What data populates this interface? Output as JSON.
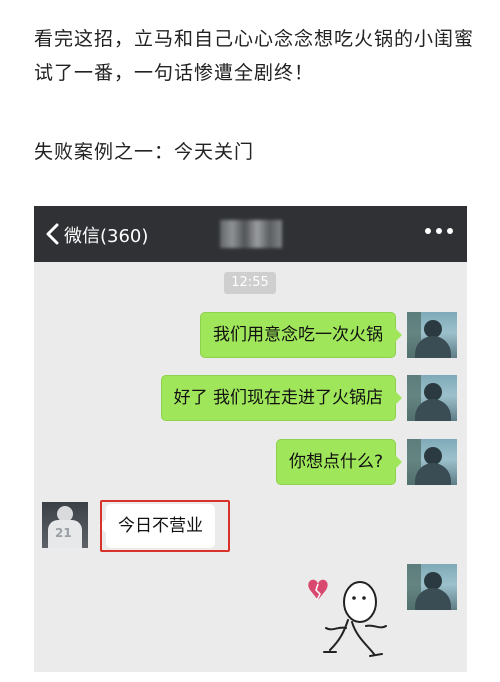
{
  "article": {
    "intro": "看完这招，立马和自己心心念念想吃火锅的小闺蜜试了一番，一句话惨遭全剧终！",
    "case_title": "失败案例之一：今天关门"
  },
  "chat": {
    "header": {
      "back_label": "微信(360)"
    },
    "timestamp": "12:55",
    "messages_out": [
      "我们用意念吃一次火锅",
      "好了 我们现在走进了火锅店",
      "你想点什么?"
    ],
    "message_in": "今日不营业",
    "other_avatar_number": "21"
  },
  "colors": {
    "header_bg": "#2f3134",
    "chat_bg": "#ebebeb",
    "outgoing_bubble": "#9fe65a",
    "highlight_box": "#d8322a"
  }
}
